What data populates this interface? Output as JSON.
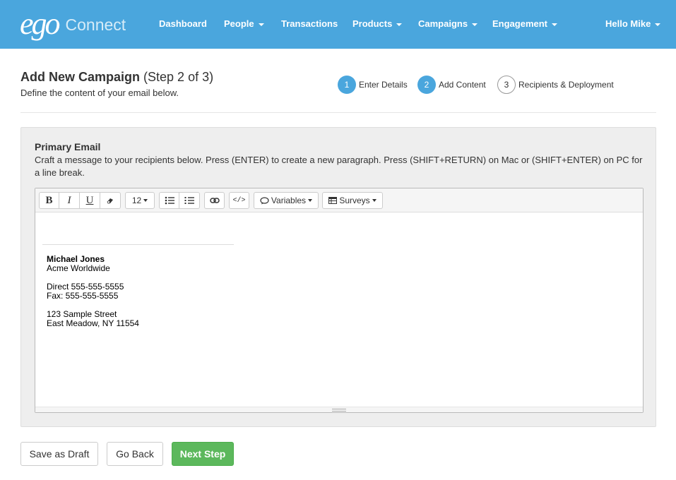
{
  "brand": {
    "logo_ego": "ego",
    "logo_connect": "Connect"
  },
  "nav": {
    "dashboard": "Dashboard",
    "people": "People",
    "transactions": "Transactions",
    "products": "Products",
    "campaigns": "Campaigns",
    "engagement": "Engagement",
    "user": "Hello Mike"
  },
  "header": {
    "title": "Add New Campaign",
    "step_text": "(Step 2 of 3)",
    "subtitle": "Define the content of your email below."
  },
  "steps": [
    {
      "num": "1",
      "label": "Enter Details",
      "state": "complete"
    },
    {
      "num": "2",
      "label": "Add Content",
      "state": "active"
    },
    {
      "num": "3",
      "label": "Recipients & Deployment",
      "state": "pending"
    }
  ],
  "panel": {
    "title": "Primary Email",
    "description": "Craft a message to your recipients below. Press (ENTER) to create a new paragraph. Press (SHIFT+RETURN) on Mac or (SHIFT+ENTER) on PC for a line break."
  },
  "toolbar": {
    "bold": "B",
    "italic": "I",
    "underline": "U",
    "font_size": "12",
    "variables": "Variables",
    "surveys": "Surveys"
  },
  "signature": {
    "name": "Michael Jones",
    "company": "Acme Worldwide",
    "direct": "Direct 555-555-5555",
    "fax": "Fax: 555-555-5555",
    "street": "123 Sample Street",
    "city": "East Meadow, NY 11554"
  },
  "footer": {
    "save_draft": "Save as Draft",
    "go_back": "Go Back",
    "next_step": "Next Step"
  },
  "colors": {
    "navbar": "#4aa6dd",
    "step_active": "#4aa6dd",
    "success": "#5cb85c"
  }
}
